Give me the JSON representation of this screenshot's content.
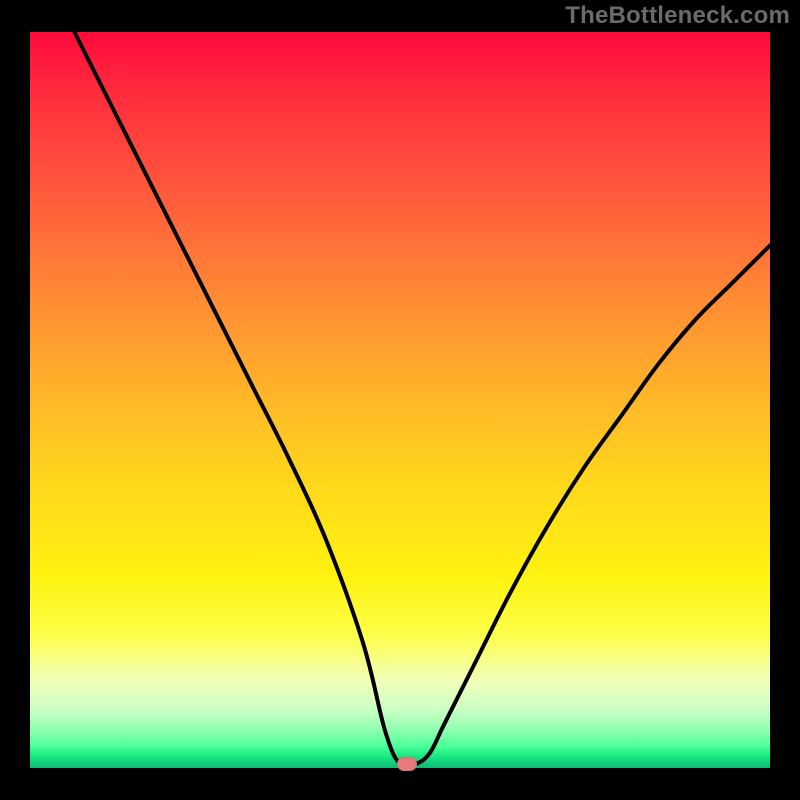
{
  "attribution": "TheBottleneck.com",
  "colors": {
    "page_bg": "#000000",
    "attribution_text": "#6b6b6b",
    "curve_stroke": "#000000",
    "marker_fill": "#e77c7c",
    "gradient_stops": [
      "#ff0a3b",
      "#ff2f3e",
      "#ff5a3c",
      "#ff8a34",
      "#ffb728",
      "#ffd91b",
      "#fff210",
      "#fdff4a",
      "#f2ffb8",
      "#ccffc4",
      "#8bffae",
      "#4dff9a",
      "#14e77f",
      "#0fb776"
    ]
  },
  "chart_data": {
    "type": "line",
    "title": "",
    "xlabel": "",
    "ylabel": "",
    "xlim": [
      0,
      100
    ],
    "ylim": [
      0,
      100
    ],
    "grid": false,
    "legend": false,
    "series": [
      {
        "name": "bottleneck-curve",
        "x": [
          6,
          10,
          15,
          20,
          25,
          30,
          35,
          40,
          45,
          48,
          50,
          52,
          54,
          56,
          60,
          65,
          70,
          75,
          80,
          85,
          90,
          95,
          100
        ],
        "y": [
          100,
          92,
          82,
          72,
          62,
          52,
          42,
          31,
          17,
          5,
          0.5,
          0.5,
          2,
          6,
          14,
          24,
          33,
          41,
          48,
          55,
          61,
          66,
          71
        ]
      }
    ],
    "marker": {
      "x": 51,
      "y": 0.5
    },
    "note": "x and y are in percent of plot area; y=100 is top, y=0 is bottom; values estimated from image"
  }
}
